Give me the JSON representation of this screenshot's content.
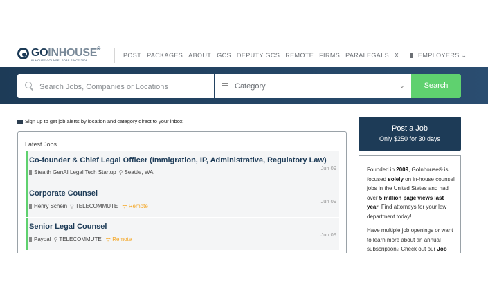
{
  "logo": {
    "brand_a": "GO",
    "brand_b": "INHOUSE",
    "reg": "®",
    "tagline": "IN-HOUSE COUNSEL JOBS SINCE 2009"
  },
  "nav": {
    "items": [
      "POST",
      "PACKAGES",
      "ABOUT",
      "GCS",
      "DEPUTY GCS",
      "REMOTE",
      "FIRMS",
      "PARALEGALS",
      "X"
    ],
    "employers": "EMPLOYERS"
  },
  "search": {
    "placeholder": "Search Jobs, Companies or Locations",
    "category_placeholder": "Category",
    "button": "Search"
  },
  "alert_text": "Sign up to get job alerts by location and category direct to your inbox!",
  "latest": {
    "heading": "Latest Jobs",
    "jobs": [
      {
        "title": "Co-founder & Chief Legal Officer (Immigration, IP, Administrative, Regulatory Law)",
        "company": "Stealth GenAI Legal Tech Startup",
        "location": "Seattle, WA",
        "remote": "",
        "date": "Jun 09"
      },
      {
        "title": "Corporate Counsel",
        "company": "Henry Schein",
        "location": "TELECOMMUTE",
        "remote": "Remote",
        "date": "Jun 09"
      },
      {
        "title": "Senior Legal Counsel",
        "company": "Paypal",
        "location": "TELECOMMUTE",
        "remote": "Remote",
        "date": "Jun 09"
      }
    ]
  },
  "post_job": {
    "title": "Post a Job",
    "subtitle": "Only $250 for 30 days"
  },
  "about": {
    "p1_a": "Founded in ",
    "p1_year": "2009",
    "p1_b": ", GoInhouse® is focused ",
    "p1_solely": "solely",
    "p1_c": " on in-house counsel jobs in the United States and had over ",
    "p1_views": "5 million page views last year",
    "p1_d": "! Find attorneys for your law department today!",
    "p2_a": "Have multiple job openings or want to learn more about an annual subscription? Check out our ",
    "p2_link": "Job"
  },
  "colors": {
    "navy": "#1d3b57",
    "green": "#5fd16f",
    "orange": "#f5a623"
  }
}
